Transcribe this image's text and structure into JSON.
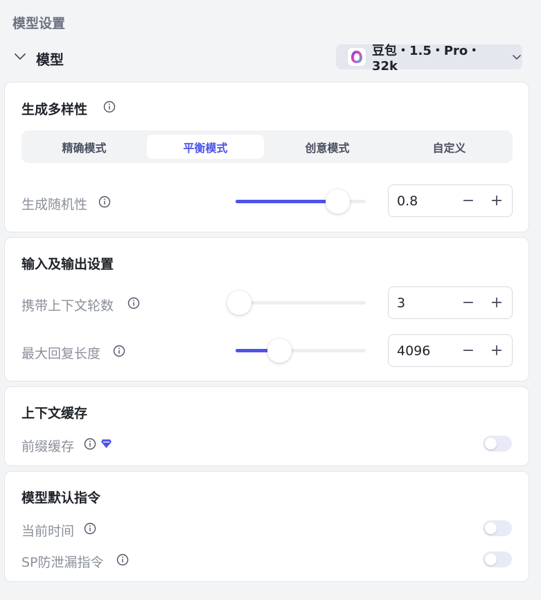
{
  "page": {
    "title": "模型设置"
  },
  "model": {
    "label": "模型",
    "selected": "豆包・1.5・Pro・32k"
  },
  "diversity": {
    "title": "生成多样性",
    "modes": [
      "精确模式",
      "平衡模式",
      "创意模式",
      "自定义"
    ],
    "active_mode": "平衡模式",
    "randomness": {
      "label": "生成随机性",
      "value": "0.8",
      "slider_fraction": 0.8
    }
  },
  "io": {
    "title": "输入及输出设置",
    "context_rounds": {
      "label": "携带上下文轮数",
      "value": "3",
      "slider_fraction": 0.0
    },
    "max_length": {
      "label": "最大回复长度",
      "value": "4096",
      "slider_fraction": 0.33
    }
  },
  "cache": {
    "title": "上下文缓存",
    "prefix_cache": {
      "label": "前缀缓存",
      "enabled": false
    }
  },
  "default_instructions": {
    "title": "模型默认指令",
    "current_time": {
      "label": "当前时间",
      "enabled": false
    },
    "sp_leak_guard": {
      "label": "SP防泄漏指令",
      "enabled": false
    }
  },
  "stepper": {
    "minus": "−",
    "plus": "+"
  },
  "colors": {
    "accent": "#4d53e8",
    "toggle_off": "#e9eaf7",
    "premium": "#4d53e8"
  },
  "icons": [
    "chevron-down-icon",
    "model-logo-icon",
    "info-icon",
    "premium-gem-icon",
    "minus-icon",
    "plus-icon"
  ]
}
